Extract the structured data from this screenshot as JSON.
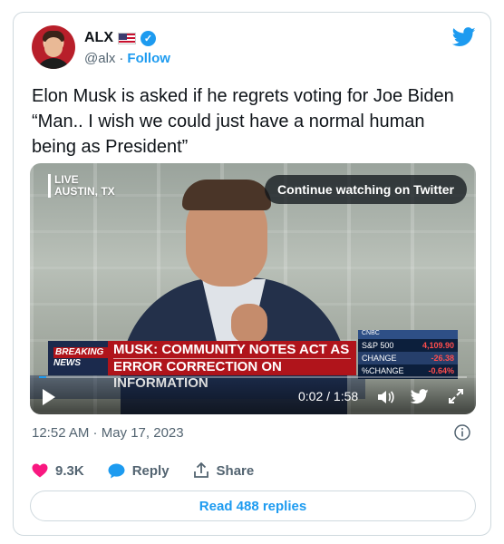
{
  "author": {
    "display_name": "ALX",
    "handle": "@alx",
    "separator": "·",
    "follow_label": "Follow"
  },
  "tweet": {
    "text": "Elon Musk is asked if he regrets voting for Joe Biden\n“Man.. I wish we could just have a normal human\nbeing as President”",
    "timestamp": "12:52 AM · May 17, 2023"
  },
  "video": {
    "live_line1": "LIVE",
    "live_line2": "AUSTIN, TX",
    "continue_label": "Continue watching on Twitter",
    "breaking_line1": "BREAKING",
    "breaking_line2": "NEWS",
    "headline_line1": "MUSK: COMMUNITY NOTES ACT AS",
    "headline_line2": "ERROR CORRECTION ON INFORMATION",
    "stock_brand": "CNBC",
    "stock_index": "S&P 500",
    "stock_value": "4,109.90",
    "stock_change_label": "CHANGE",
    "stock_change": "-26.38",
    "stock_pct_label": "%CHANGE",
    "stock_pct": "-0.64%",
    "time_display": "0:02 / 1:58",
    "progress_fraction": 0.017
  },
  "actions": {
    "likes": "9.3K",
    "reply_label": "Reply",
    "share_label": "Share"
  },
  "read_replies_label": "Read 488 replies",
  "colors": {
    "accent": "#1d9bf0",
    "like": "#f91880",
    "text_secondary": "#536471",
    "border": "#cfd9de"
  },
  "icons": [
    "verified-badge-icon",
    "us-flag-icon",
    "twitter-bird-icon",
    "play-icon",
    "volume-icon",
    "expand-icon",
    "info-icon",
    "heart-icon",
    "reply-bubble-icon",
    "share-icon"
  ]
}
